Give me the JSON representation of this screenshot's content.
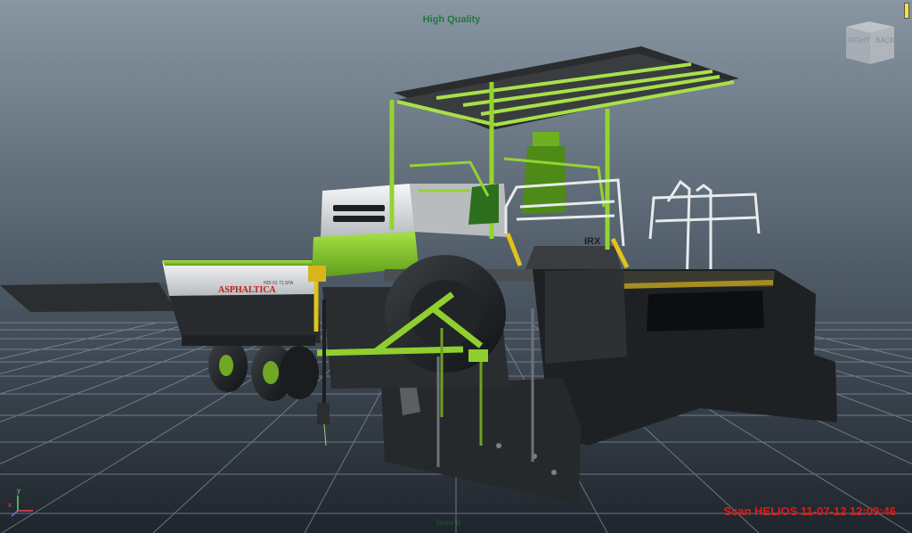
{
  "viewport": {
    "quality_label": "High Quality",
    "background_top": "#7f8c99",
    "background_bottom": "#2d3540",
    "grid_color": "#8b95a1"
  },
  "viewcube": {
    "left_face": "RIGHT",
    "right_face": "BACK"
  },
  "axis": {
    "x": "x",
    "y": "y"
  },
  "scene": {
    "brand_text": "ASPHALTICA",
    "brand_small": "HDI 01 71 STA",
    "body_color": "#8fcf2f",
    "body_dark": "#2a2f30",
    "body_white": "#e8eaec",
    "accent_red": "#c21a1a",
    "hydraulic": "#e2c31b",
    "floor_label": "Ground"
  },
  "status": {
    "stamp": "Scan HELIOS 11-07-12 12:09:46"
  }
}
